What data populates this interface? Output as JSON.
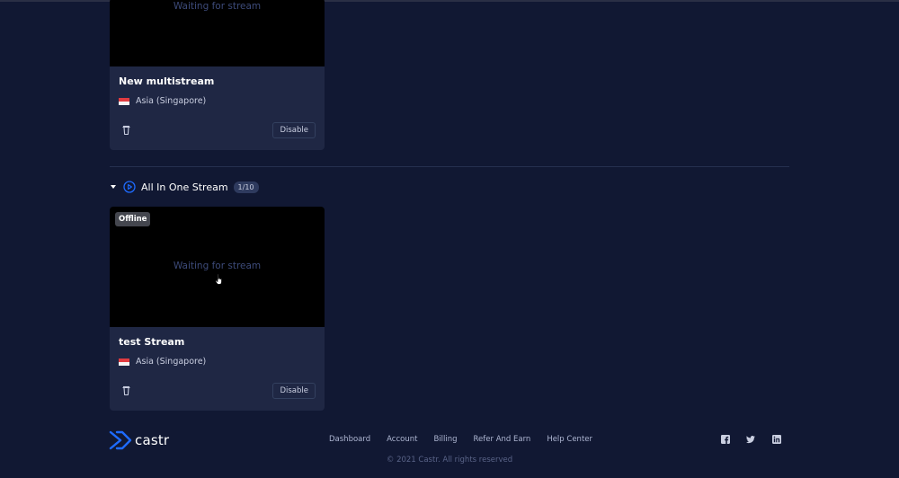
{
  "cards": [
    {
      "waiting_text": "Waiting for stream",
      "title": "New multistream",
      "region": "Asia (Singapore)",
      "disable_label": "Disable"
    },
    {
      "status_badge": "Offline",
      "waiting_text": "Waiting for stream",
      "title": "test Stream",
      "region": "Asia (Singapore)",
      "disable_label": "Disable"
    }
  ],
  "group": {
    "title": "All In One Stream",
    "count": "1/10"
  },
  "footer": {
    "logo_text": "castr",
    "nav": [
      "Dashboard",
      "Account",
      "Billing",
      "Refer And Earn",
      "Help Center"
    ],
    "copyright": "© 2021 Castr. All rights reserved",
    "social_icons": [
      "facebook-icon",
      "twitter-icon",
      "linkedin-icon"
    ]
  },
  "colors": {
    "background": "#111833",
    "card": "#1f2744",
    "accent": "#1e6bff"
  }
}
